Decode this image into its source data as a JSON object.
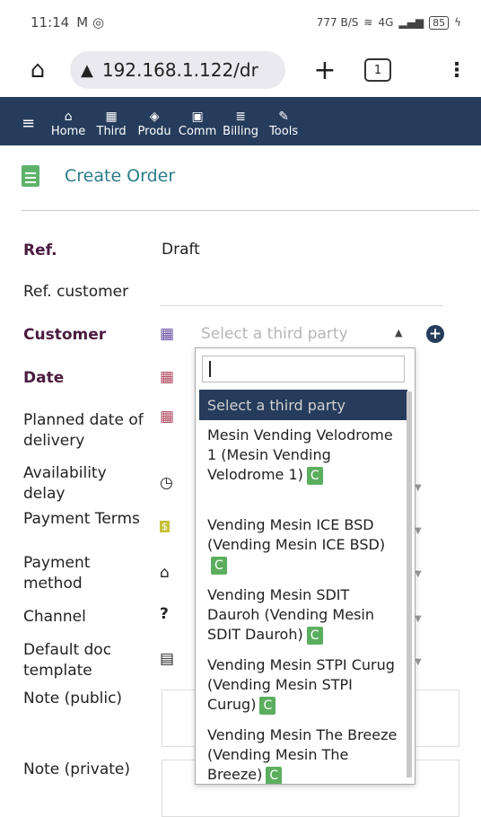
{
  "status": {
    "time": "11:14",
    "left_icons": "M ◎",
    "speed": "777 B/S",
    "network": "4G",
    "battery": "85"
  },
  "browser": {
    "url": "192.168.1.122/dr",
    "tab_count": "1"
  },
  "nav": {
    "items": [
      {
        "label": "Home"
      },
      {
        "label": "Third"
      },
      {
        "label": "Produ"
      },
      {
        "label": "Comm"
      },
      {
        "label": "Billing"
      },
      {
        "label": "Tools"
      }
    ]
  },
  "page": {
    "title": "Create Order"
  },
  "form": {
    "ref_label": "Ref.",
    "ref_value": "Draft",
    "ref_customer_label": "Ref. customer",
    "customer_label": "Customer",
    "customer_placeholder": "Select a third party",
    "date_label": "Date",
    "planned_delivery_label": "Planned date of delivery",
    "availability_label": "Availability delay",
    "payment_terms_label": "Payment Terms",
    "payment_method_label": "Payment method",
    "channel_label": "Channel",
    "doc_template_label": "Default doc template",
    "note_public_label": "Note (public)",
    "note_private_label": "Note (private)"
  },
  "dropdown": {
    "search_value": "",
    "header_option": "Select a third party",
    "badge": "C",
    "options": [
      {
        "label": "Mesin Vending Velodrome 1 (Mesin Vending Velodrome 1)"
      },
      {
        "label": "Vending Mesin ICE BSD (Vending Mesin ICE BSD)"
      },
      {
        "label": "Vending Mesin SDIT Dauroh (Vending Mesin SDIT Dauroh)"
      },
      {
        "label": "Vending Mesin STPI Curug (Vending Mesin STPI Curug)"
      },
      {
        "label": "Vending Mesin The Breeze (Vending Mesin The Breeze)"
      }
    ]
  },
  "colors": {
    "navbar": "#263c5c",
    "title": "#2a7d8a",
    "required_label": "#4b1c3f",
    "badge": "#5cae5f"
  }
}
